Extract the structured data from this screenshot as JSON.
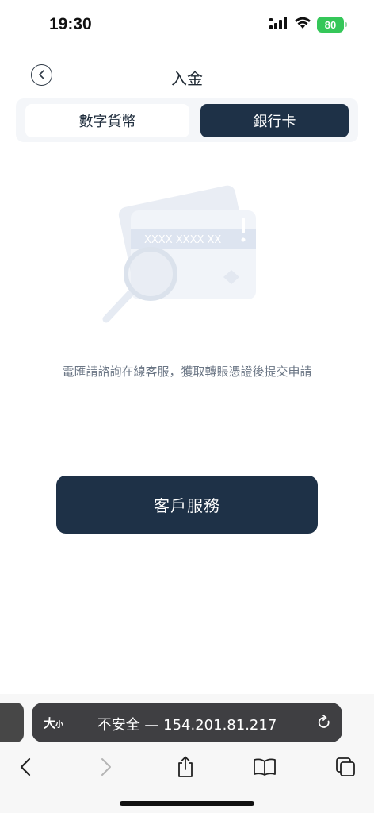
{
  "status_bar": {
    "time": "19:30",
    "battery": "80",
    "icons": [
      "signal-icon",
      "wifi-icon",
      "battery-icon"
    ]
  },
  "header": {
    "title": "入金",
    "back_icon": "chevron-left-icon"
  },
  "tabs": {
    "items": [
      {
        "label": "數字貨幣",
        "selected": false
      },
      {
        "label": "銀行卡",
        "selected": true
      }
    ]
  },
  "main": {
    "illustration": "bank-card-search-illustration",
    "card_number_mask": "XXXX XXXX XX",
    "hint": "電匯請諮詢在線客服，獲取轉賬憑證後提交申請",
    "service_button_label": "客戶服務"
  },
  "browser": {
    "text_size_label": "大",
    "text_size_small": "小",
    "url": "不安全 — 154.201.81.217",
    "toolbar_icons": [
      "back-icon",
      "forward-icon",
      "share-icon",
      "bookmarks-icon",
      "tabs-icon"
    ]
  },
  "colors": {
    "primary": "#1e3147",
    "tabs_bg": "#f4f6f9",
    "hint_text": "#6b7685",
    "battery": "#35c759"
  }
}
